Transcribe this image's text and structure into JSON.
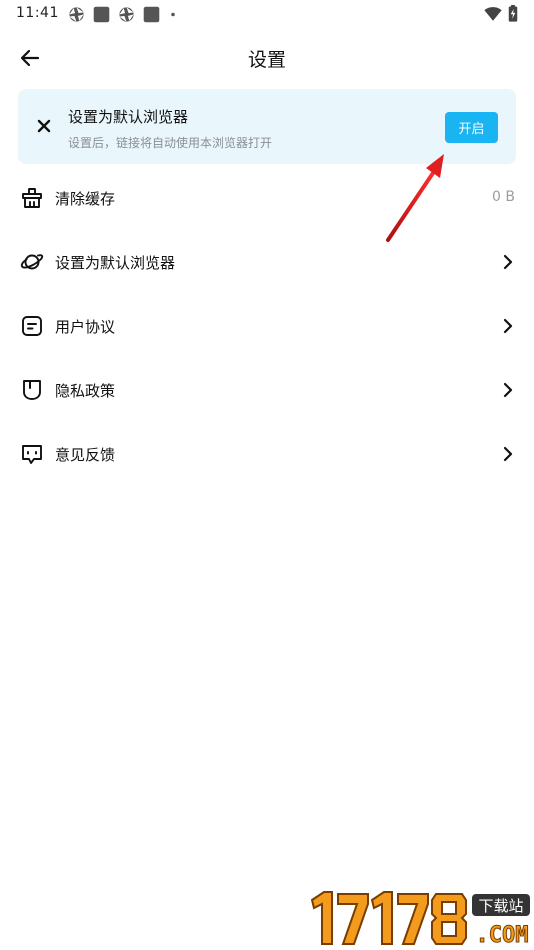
{
  "status_bar": {
    "time": "11:41"
  },
  "header": {
    "title": "设置"
  },
  "banner": {
    "title": "设置为默认浏览器",
    "subtitle": "设置后，链接将自动使用本浏览器打开",
    "button_label": "开启"
  },
  "settings": {
    "items": [
      {
        "label": "清除缓存",
        "value": "0 B",
        "icon": "basket-icon"
      },
      {
        "label": "设置为默认浏览器",
        "icon": "planet-icon"
      },
      {
        "label": "用户协议",
        "icon": "document-icon"
      },
      {
        "label": "隐私政策",
        "icon": "shield-icon"
      },
      {
        "label": "意见反馈",
        "icon": "chat-bubble-icon"
      }
    ]
  },
  "watermark": {
    "text": "17178",
    "badge": "下载站",
    "suffix": ".COM"
  },
  "colors": {
    "accent": "#19b4f2",
    "banner_bg": "#e9f6fb",
    "arrow": "#e02020"
  }
}
